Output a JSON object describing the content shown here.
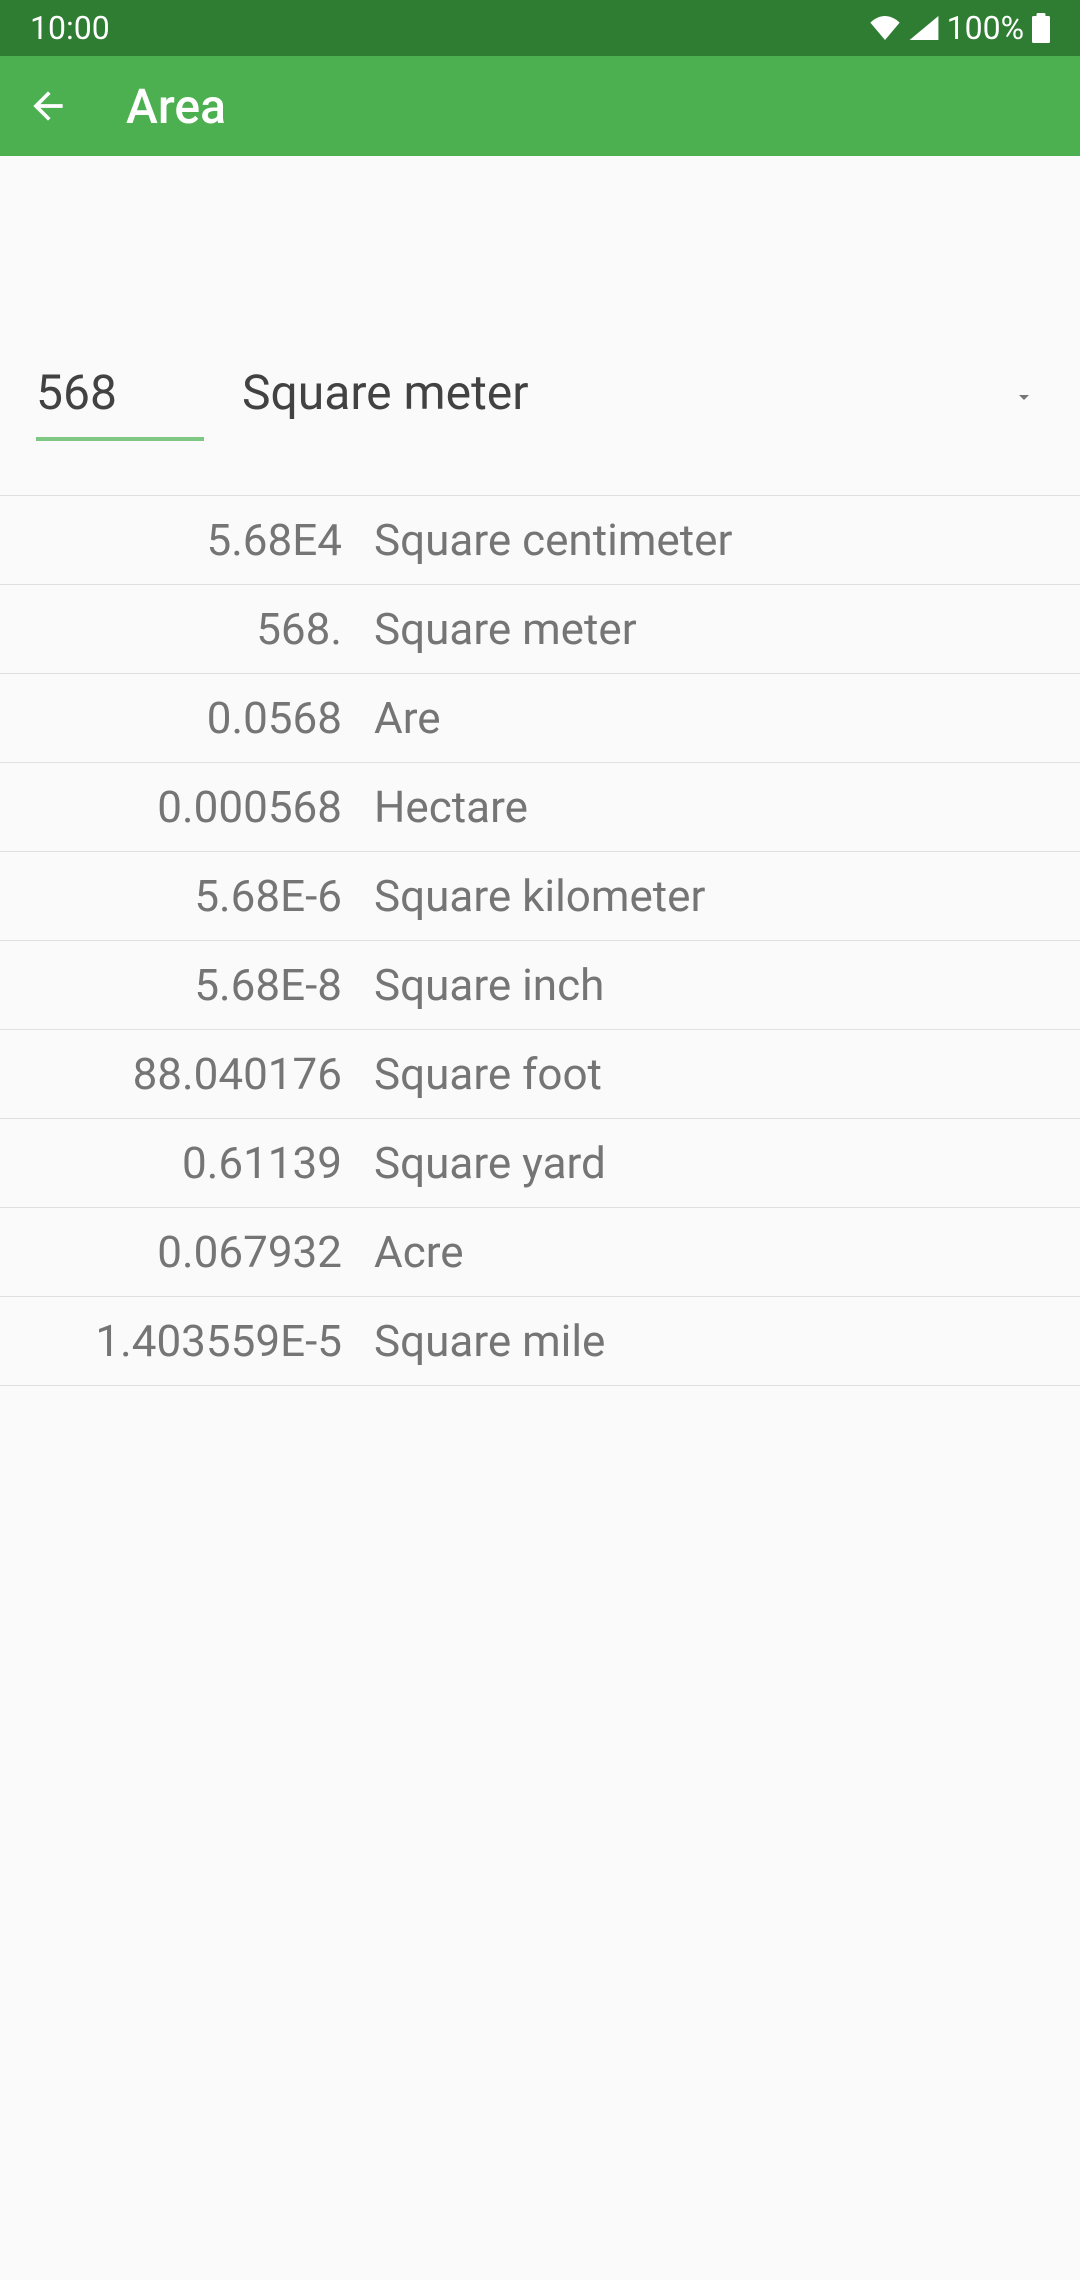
{
  "statusBar": {
    "time": "10:00",
    "battery": "100%"
  },
  "appBar": {
    "title": "Area"
  },
  "input": {
    "value": "568",
    "selectedUnit": "Square meter"
  },
  "results": [
    {
      "value": "5.68E4",
      "unit": "Square centimeter"
    },
    {
      "value": "568.",
      "unit": "Square meter"
    },
    {
      "value": "0.0568",
      "unit": "Are"
    },
    {
      "value": "0.000568",
      "unit": "Hectare"
    },
    {
      "value": "5.68E-6",
      "unit": "Square kilometer"
    },
    {
      "value": "5.68E-8",
      "unit": "Square inch"
    },
    {
      "value": "88.040176",
      "unit": "Square foot"
    },
    {
      "value": "0.61139",
      "unit": "Square yard"
    },
    {
      "value": "0.067932",
      "unit": "Acre"
    },
    {
      "value": "1.403559E-5",
      "unit": "Square mile"
    }
  ]
}
